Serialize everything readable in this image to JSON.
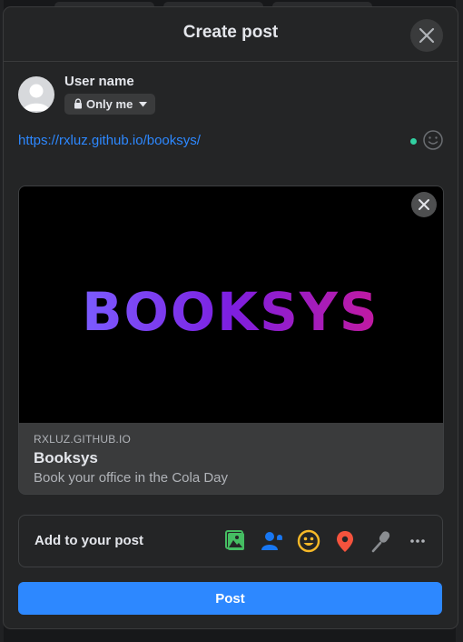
{
  "dialog": {
    "title": "Create post"
  },
  "composer": {
    "user_name": "User name",
    "privacy": {
      "label": "Only me",
      "icon": "lock-icon"
    },
    "text": "https://rxluz.github.io/booksys/"
  },
  "link_preview": {
    "image_text": "BOOKSYS",
    "domain": "RXLUZ.GITHUB.IO",
    "title": "Booksys",
    "description": "Book your office in the Cola Day"
  },
  "add_to_post": {
    "label": "Add to your post",
    "tools": [
      "photo-video-icon",
      "tag-people-icon",
      "feeling-icon",
      "check-in-icon",
      "live-video-icon",
      "more-icon"
    ]
  },
  "actions": {
    "post_label": "Post"
  },
  "colors": {
    "accent": "#2d88ff",
    "background": "#242526",
    "text": "#e4e6eb",
    "muted": "#b0b3b8"
  }
}
